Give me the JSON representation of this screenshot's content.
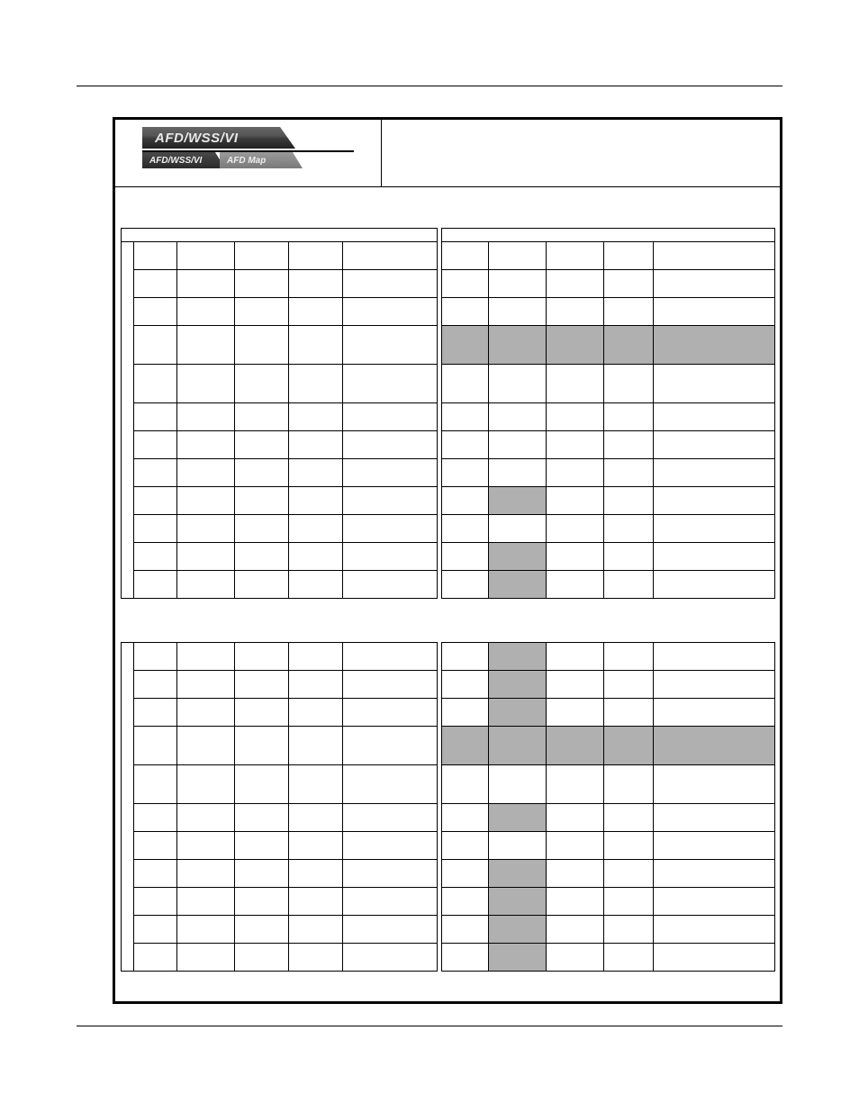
{
  "header": {
    "big_tab": "AFD/WSS/VI",
    "tab_active": "AFD/WSS/VI",
    "tab_inactive": "AFD Map"
  },
  "grid": {
    "sectionA": {
      "head_span": "",
      "rows": [
        {
          "c": [
            "",
            "",
            "",
            "",
            ""
          ]
        },
        {
          "c": [
            "",
            "",
            "",
            "",
            ""
          ]
        },
        {
          "c": [
            "",
            "",
            "",
            "",
            ""
          ]
        },
        {
          "c": [
            "",
            "",
            "",
            "",
            ""
          ],
          "big": true
        },
        {
          "c": [
            "",
            "",
            "",
            "",
            ""
          ],
          "big": true
        },
        {
          "c": [
            "",
            "",
            "",
            "",
            ""
          ]
        },
        {
          "c": [
            "",
            "",
            "",
            "",
            ""
          ]
        },
        {
          "c": [
            "",
            "",
            "",
            "",
            ""
          ]
        },
        {
          "c": [
            "",
            "",
            "",
            "",
            ""
          ]
        },
        {
          "c": [
            "",
            "",
            "",
            "",
            ""
          ]
        },
        {
          "c": [
            "",
            "",
            "",
            "",
            ""
          ]
        },
        {
          "c": [
            "",
            "",
            "",
            "",
            ""
          ]
        }
      ]
    },
    "sectionB": {
      "head_span": "",
      "rows": [
        {
          "c": [
            "",
            "",
            "",
            "",
            ""
          ],
          "shade": []
        },
        {
          "c": [
            "",
            "",
            "",
            "",
            ""
          ],
          "shade": []
        },
        {
          "c": [
            "",
            "",
            "",
            "",
            ""
          ],
          "shade": []
        },
        {
          "c": [
            "",
            "",
            "",
            "",
            ""
          ],
          "shade": [
            0,
            1,
            2,
            3,
            4
          ],
          "big": true
        },
        {
          "c": [
            "",
            "",
            "",
            "",
            ""
          ],
          "shade": [],
          "big": true
        },
        {
          "c": [
            "",
            "",
            "",
            "",
            ""
          ],
          "shade": []
        },
        {
          "c": [
            "",
            "",
            "",
            "",
            ""
          ],
          "shade": []
        },
        {
          "c": [
            "",
            "",
            "",
            "",
            ""
          ],
          "shade": []
        },
        {
          "c": [
            "",
            "",
            "",
            "",
            ""
          ],
          "shade": [
            1
          ]
        },
        {
          "c": [
            "",
            "",
            "",
            "",
            ""
          ],
          "shade": []
        },
        {
          "c": [
            "",
            "",
            "",
            "",
            ""
          ],
          "shade": [
            1
          ]
        },
        {
          "c": [
            "",
            "",
            "",
            "",
            ""
          ],
          "shade": [
            1
          ]
        }
      ]
    },
    "sectionC": {
      "rows": [
        {
          "c": [
            "",
            "",
            "",
            "",
            ""
          ]
        },
        {
          "c": [
            "",
            "",
            "",
            "",
            ""
          ]
        },
        {
          "c": [
            "",
            "",
            "",
            "",
            ""
          ]
        },
        {
          "c": [
            "",
            "",
            "",
            "",
            ""
          ],
          "big": true
        },
        {
          "c": [
            "",
            "",
            "",
            "",
            ""
          ],
          "big": true
        },
        {
          "c": [
            "",
            "",
            "",
            "",
            ""
          ]
        },
        {
          "c": [
            "",
            "",
            "",
            "",
            ""
          ]
        },
        {
          "c": [
            "",
            "",
            "",
            "",
            ""
          ]
        },
        {
          "c": [
            "",
            "",
            "",
            "",
            ""
          ]
        },
        {
          "c": [
            "",
            "",
            "",
            "",
            ""
          ]
        },
        {
          "c": [
            "",
            "",
            "",
            "",
            ""
          ]
        }
      ]
    },
    "sectionD": {
      "rows": [
        {
          "c": [
            "",
            "",
            "",
            "",
            ""
          ],
          "shade": [
            1
          ]
        },
        {
          "c": [
            "",
            "",
            "",
            "",
            ""
          ],
          "shade": [
            1
          ]
        },
        {
          "c": [
            "",
            "",
            "",
            "",
            ""
          ],
          "shade": [
            1
          ]
        },
        {
          "c": [
            "",
            "",
            "",
            "",
            ""
          ],
          "shade": [
            0,
            1,
            2,
            3,
            4
          ],
          "big": true
        },
        {
          "c": [
            "",
            "",
            "",
            "",
            ""
          ],
          "shade": [],
          "big": true
        },
        {
          "c": [
            "",
            "",
            "",
            "",
            ""
          ],
          "shade": [
            1
          ]
        },
        {
          "c": [
            "",
            "",
            "",
            "",
            ""
          ],
          "shade": []
        },
        {
          "c": [
            "",
            "",
            "",
            "",
            ""
          ],
          "shade": [
            1
          ]
        },
        {
          "c": [
            "",
            "",
            "",
            "",
            ""
          ],
          "shade": [
            1
          ]
        },
        {
          "c": [
            "",
            "",
            "",
            "",
            ""
          ],
          "shade": [
            1
          ]
        },
        {
          "c": [
            "",
            "",
            "",
            "",
            ""
          ],
          "shade": [
            1
          ]
        }
      ]
    }
  }
}
